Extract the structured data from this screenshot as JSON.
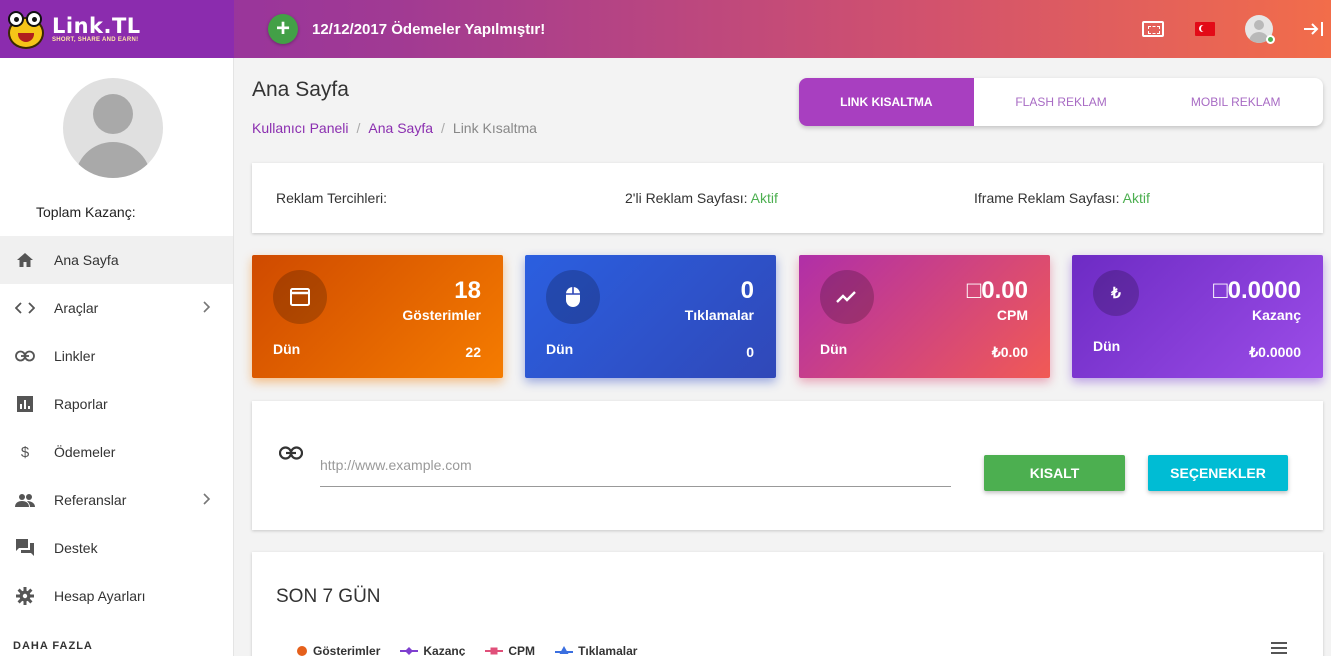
{
  "brand": {
    "name": "Link.TL",
    "tagline": "SHORT, SHARE AND EARN!"
  },
  "topbar": {
    "announcement": "12/12/2017 Ödemeler Yapılmıştır!"
  },
  "sidebar": {
    "earnings_label": "Toplam Kazanç:",
    "items": [
      {
        "label": "Ana Sayfa",
        "icon": "home-icon"
      },
      {
        "label": "Araçlar",
        "icon": "code-icon"
      },
      {
        "label": "Linkler",
        "icon": "link-icon"
      },
      {
        "label": "Raporlar",
        "icon": "bar-chart-icon"
      },
      {
        "label": "Ödemeler",
        "icon": "dollar-icon"
      },
      {
        "label": "Referanslar",
        "icon": "people-icon"
      },
      {
        "label": "Destek",
        "icon": "forum-icon"
      },
      {
        "label": "Hesap Ayarları",
        "icon": "gear-icon"
      }
    ],
    "more_label": "DAHA FAZLA"
  },
  "header": {
    "title": "Ana Sayfa",
    "breadcrumb": [
      "Kullanıcı Paneli",
      "Ana Sayfa",
      "Link Kısaltma"
    ],
    "tabs": [
      "LINK KISALTMA",
      "FLASH REKLAM",
      "MOBIL REKLAM"
    ]
  },
  "prefs": {
    "label": "Reklam Tercihleri:",
    "two_page_label": "2'li Reklam Sayfası:",
    "two_page_value": "Aktif",
    "iframe_label": "Iframe Reklam Sayfası:",
    "iframe_value": "Aktif"
  },
  "stats": [
    {
      "value": "18",
      "label": "Gösterimler",
      "sub_label": "Dün",
      "sub_value": "22",
      "icon": "window-icon"
    },
    {
      "value": "0",
      "label": "Tıklamalar",
      "sub_label": "Dün",
      "sub_value": "0",
      "icon": "mouse-icon"
    },
    {
      "value": "□0.00",
      "label": "CPM",
      "sub_label": "Dün",
      "sub_value": "₺0.00",
      "icon": "trending-icon"
    },
    {
      "value": "□0.0000",
      "label": "Kazanç",
      "sub_label": "Dün",
      "sub_value": "₺0.0000",
      "icon": "lira-icon"
    }
  ],
  "shorten": {
    "placeholder": "http://www.example.com",
    "value": "",
    "shorten_label": "KISALT",
    "options_label": "SEÇENEKLER"
  },
  "chart": {
    "title": "SON 7 GÜN",
    "legend": [
      {
        "name": "Gösterimler",
        "color": "#e5601b",
        "marker": "circle"
      },
      {
        "name": "Kazanç",
        "color": "#7e3fcf",
        "marker": "diamond"
      },
      {
        "name": "CPM",
        "color": "#e0507a",
        "marker": "square"
      },
      {
        "name": "Tıklamalar",
        "color": "#3b6fe0",
        "marker": "triangle"
      }
    ]
  },
  "colors": {
    "accent": "#a83fc0",
    "success": "#4caf50",
    "info": "#00bcd4"
  }
}
